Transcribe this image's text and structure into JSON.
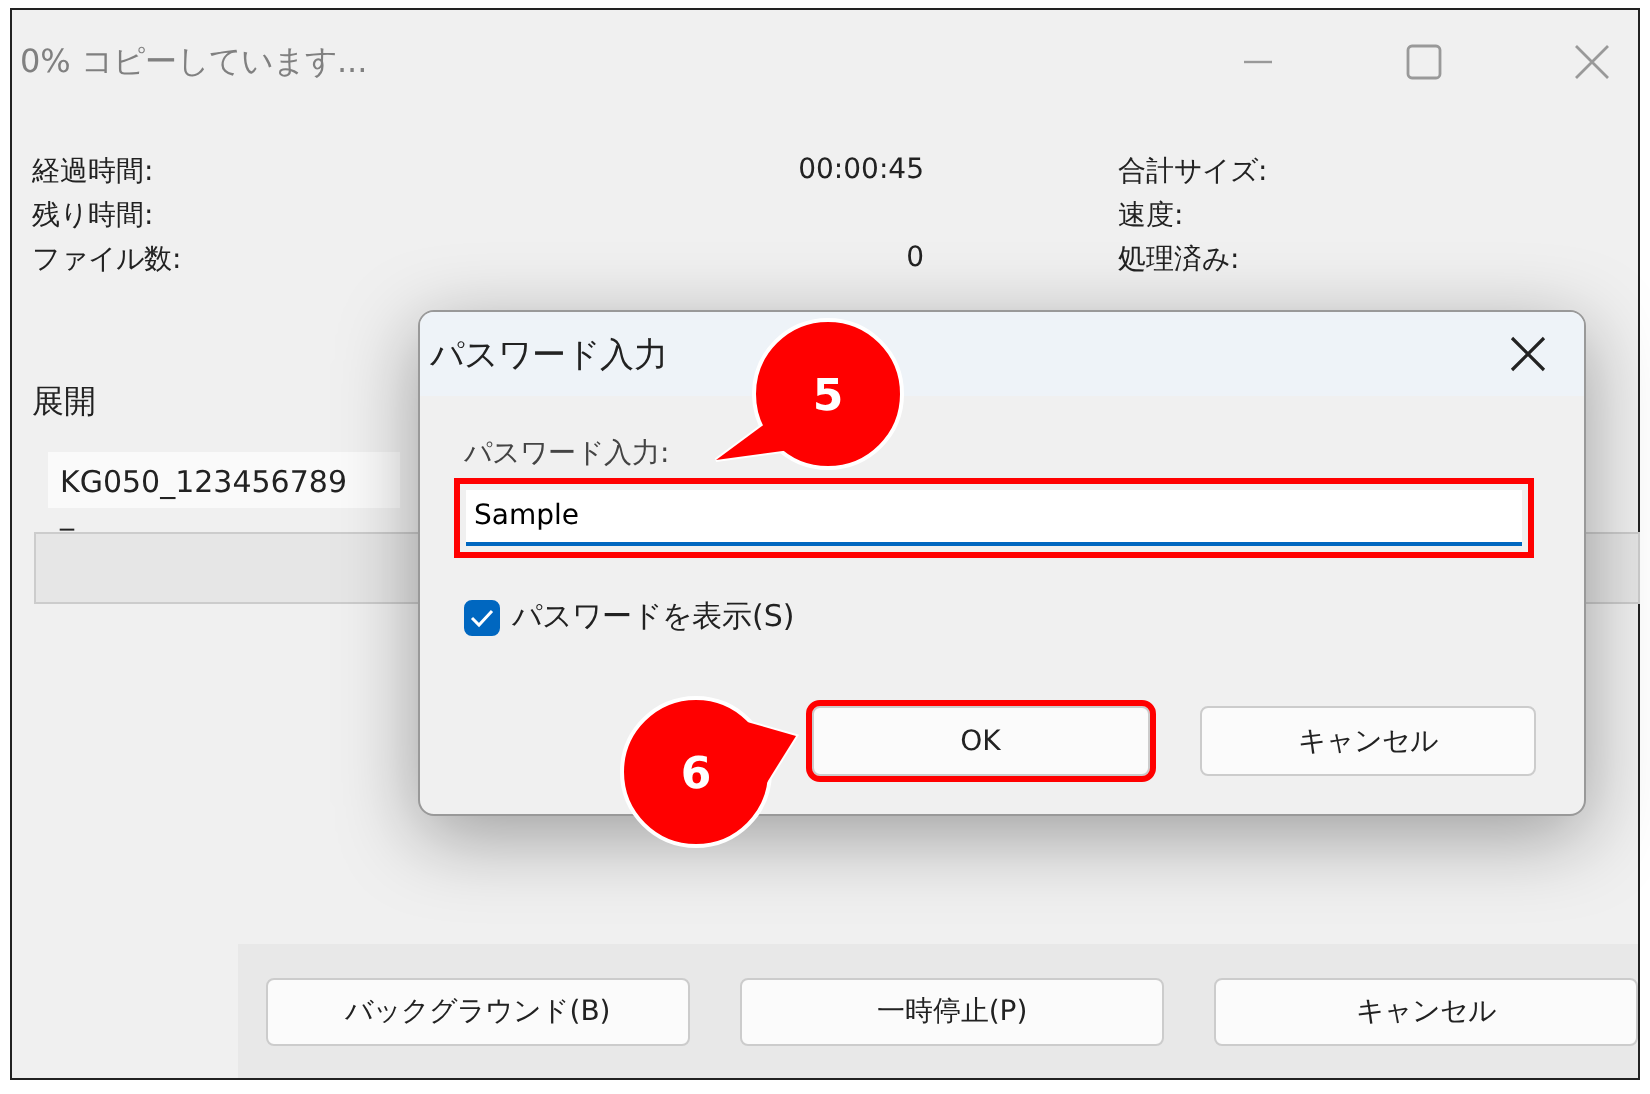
{
  "window": {
    "title": "0% コピーしています...",
    "stats": [
      {
        "label": "経過時間:",
        "value": "00:00:45",
        "label_2": "合計サイズ:"
      },
      {
        "label": "残り時間:",
        "label_2": "速度:"
      },
      {
        "label": "ファイル数:",
        "value": "0",
        "label_2": "処理済み:"
      }
    ],
    "section": "展開",
    "file": "KG050_123456789",
    "file_line_2": "_",
    "progress": {
      "level": 0
    },
    "buttons": [
      "バックグラウンド(B)",
      "一時停止(P)",
      "キャンセル"
    ]
  },
  "dialog": {
    "title": "パスワード入力",
    "field_label": "パスワード入力:",
    "field": {
      "value": "Sample",
      "highlighted": true
    },
    "show_password": {
      "label": "パスワードを表示(S)",
      "checked": true
    },
    "buttons": [
      {
        "label": "OK",
        "highlighted": true
      },
      {
        "label": "キャンセル",
        "highlighted": false
      }
    ]
  },
  "callouts": [
    {
      "number": "5"
    },
    {
      "number": "6"
    }
  ]
}
